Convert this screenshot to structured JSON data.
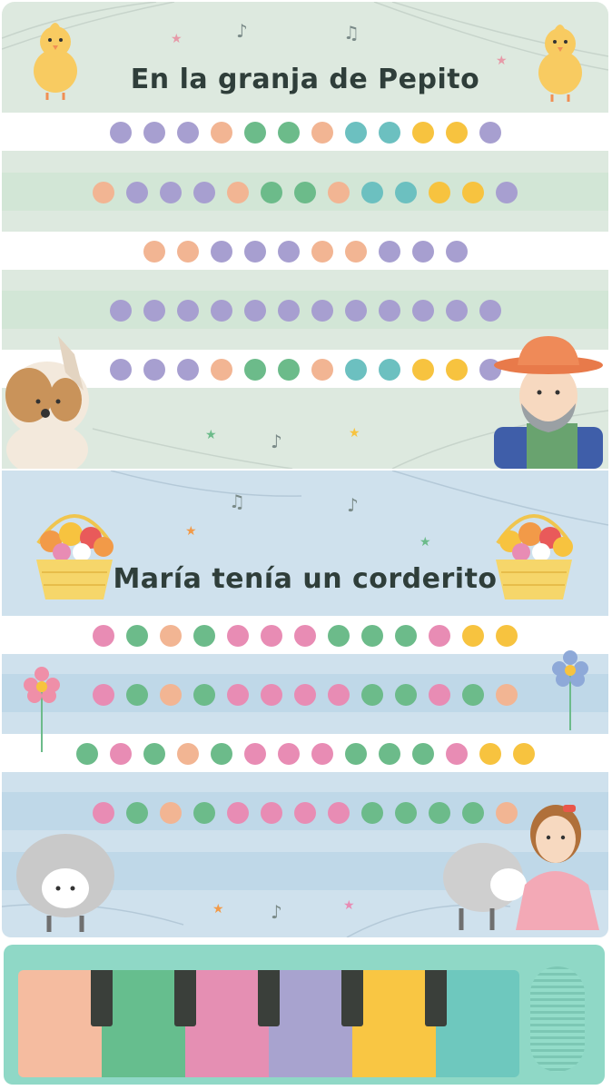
{
  "page1": {
    "title": "En la granja de Pepito",
    "rows": [
      [
        "#a79fd0",
        "#a79fd0",
        "#a79fd0",
        "#f2b593",
        "#6cbb8a",
        "#6cbb8a",
        "#f2b593",
        "#6cc0c0",
        "#6cc0c0",
        "#f7c33f",
        "#f7c33f",
        "#a79fd0"
      ],
      [
        "#f2b593",
        "#a79fd0",
        "#a79fd0",
        "#a79fd0",
        "#f2b593",
        "#6cbb8a",
        "#6cbb8a",
        "#f2b593",
        "#6cc0c0",
        "#6cc0c0",
        "#f7c33f",
        "#f7c33f",
        "#a79fd0"
      ],
      [
        "#f2b593",
        "#f2b593",
        "#a79fd0",
        "#a79fd0",
        "#a79fd0",
        "#f2b593",
        "#f2b593",
        "#a79fd0",
        "#a79fd0",
        "#a79fd0"
      ],
      [
        "#a79fd0",
        "#a79fd0",
        "#a79fd0",
        "#a79fd0",
        "#a79fd0",
        "#a79fd0",
        "#a79fd0",
        "#a79fd0",
        "#a79fd0",
        "#a79fd0",
        "#a79fd0",
        "#a79fd0"
      ],
      [
        "#a79fd0",
        "#a79fd0",
        "#a79fd0",
        "#f2b593",
        "#6cbb8a",
        "#6cbb8a",
        "#f2b593",
        "#6cc0c0",
        "#6cc0c0",
        "#f7c33f",
        "#f7c33f",
        "#a79fd0"
      ]
    ]
  },
  "page2": {
    "title": "María tenía un corderito",
    "rows": [
      [
        "#e88cb4",
        "#6cbb8a",
        "#f2b593",
        "#6cbb8a",
        "#e88cb4",
        "#e88cb4",
        "#e88cb4",
        "#6cbb8a",
        "#6cbb8a",
        "#6cbb8a",
        "#e88cb4",
        "#f7c33f",
        "#f7c33f"
      ],
      [
        "#e88cb4",
        "#6cbb8a",
        "#f2b593",
        "#6cbb8a",
        "#e88cb4",
        "#e88cb4",
        "#e88cb4",
        "#e88cb4",
        "#6cbb8a",
        "#6cbb8a",
        "#e88cb4",
        "#6cbb8a",
        "#f2b593"
      ],
      [
        "#6cbb8a",
        "#e88cb4",
        "#6cbb8a",
        "#f2b593",
        "#6cbb8a",
        "#e88cb4",
        "#e88cb4",
        "#e88cb4",
        "#6cbb8a",
        "#6cbb8a",
        "#6cbb8a",
        "#e88cb4",
        "#f7c33f",
        "#f7c33f"
      ],
      [
        "#e88cb4",
        "#6cbb8a",
        "#f2b593",
        "#6cbb8a",
        "#e88cb4",
        "#e88cb4",
        "#e88cb4",
        "#e88cb4",
        "#6cbb8a",
        "#6cbb8a",
        "#6cbb8a",
        "#6cbb8a",
        "#f2b593"
      ]
    ]
  },
  "keyboard": {
    "key_colors": [
      "#f5bca0",
      "#66be8e",
      "#e58fb3",
      "#a8a3cf",
      "#f9c643",
      "#6ec8be"
    ]
  },
  "colors": {
    "lilac": "#a79fd0",
    "peach": "#f2b593",
    "green": "#6cbb8a",
    "teal": "#6cc0c0",
    "yellow": "#f7c33f",
    "pink": "#e88cb4"
  }
}
